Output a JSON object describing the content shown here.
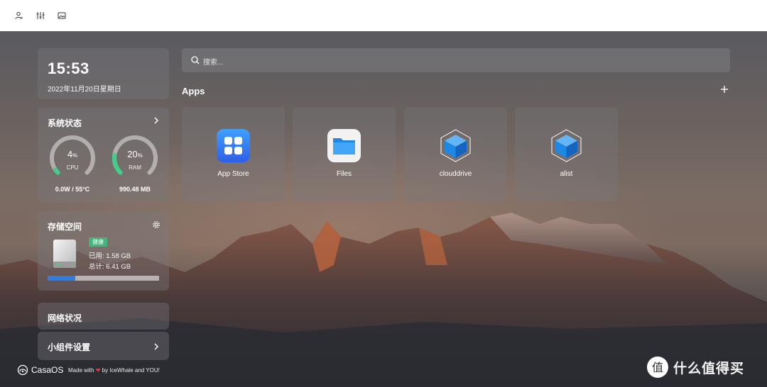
{
  "toolbar": {
    "icons": [
      "user-settings-icon",
      "sliders-icon",
      "image-icon"
    ]
  },
  "widgets": {
    "time": {
      "time": "15:53",
      "date": "2022年11月20日星期日"
    },
    "system_status": {
      "title": "系统状态",
      "cpu": {
        "value": "4",
        "unit": "%",
        "label": "CPU",
        "sub": "0.0W / 55°C",
        "level": 0.04
      },
      "ram": {
        "value": "20",
        "unit": "%",
        "label": "RAM",
        "sub": "990.48 MB",
        "level": 0.2
      }
    },
    "storage": {
      "title": "存储空间",
      "badge": "健康",
      "used": "已用: 1.58 GB",
      "total": "总计: 6.41 GB",
      "used_fraction": 0.25
    },
    "network": {
      "title": "网络状况"
    },
    "widget_settings": {
      "title": "小组件设置"
    }
  },
  "search": {
    "placeholder": "搜索..."
  },
  "apps": {
    "title": "Apps",
    "items": [
      {
        "label": "App Store",
        "icon": "app-store-icon"
      },
      {
        "label": "Files",
        "icon": "files-folder-icon"
      },
      {
        "label": "clouddrive",
        "icon": "cube-icon"
      },
      {
        "label": "alist",
        "icon": "cube-icon"
      }
    ]
  },
  "footer": {
    "brand": "CasaOS",
    "made_with": "Made with",
    "by": "by IceWhale and YOU!"
  },
  "watermark": {
    "text": "什么值得买"
  },
  "colors": {
    "accent_green": "#3fd08a",
    "badge_green": "#3fb87a",
    "bar_blue": "#2f7de1",
    "app_store_blue": "#3b7df5",
    "cube_blue": "#1e88e5"
  }
}
